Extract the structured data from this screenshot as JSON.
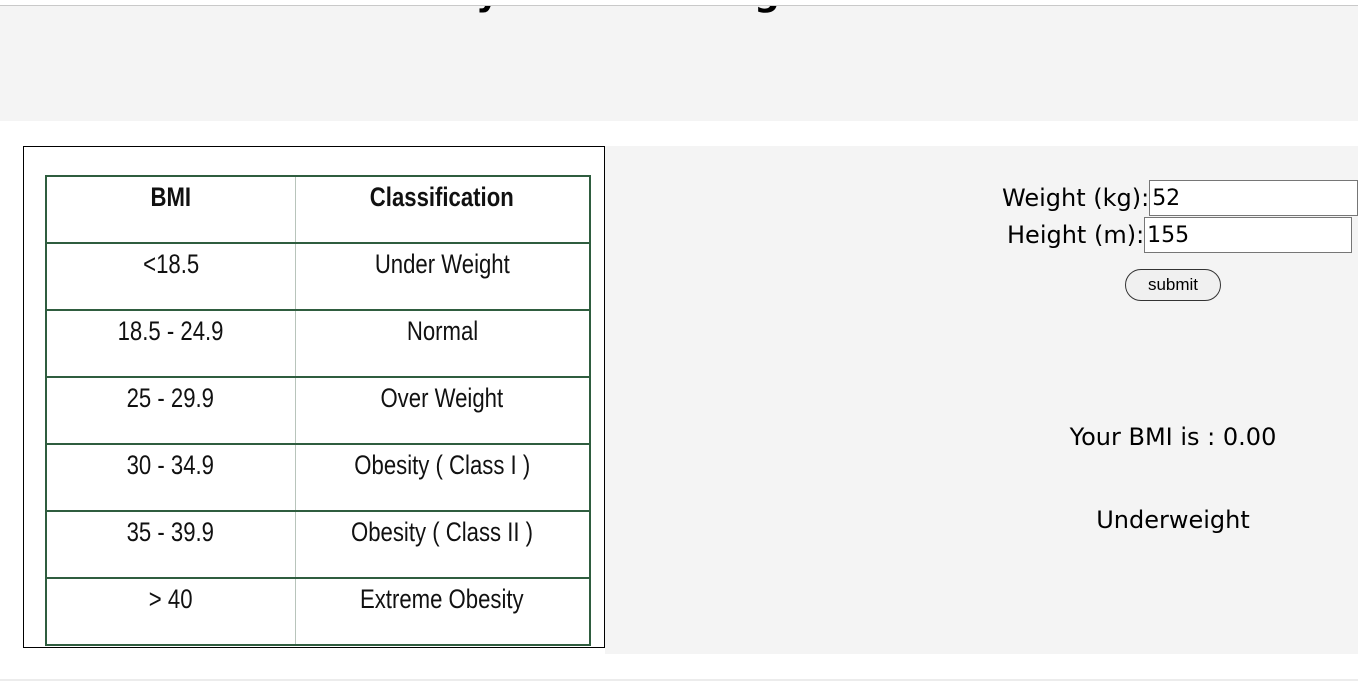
{
  "header": {
    "title": "Calculate your BMI using BMI calculator"
  },
  "bmi_table": {
    "headers": [
      "BMI",
      "Classification"
    ],
    "rows": [
      [
        "<18.5",
        "Under Weight"
      ],
      [
        "18.5 - 24.9",
        "Normal"
      ],
      [
        "25 - 29.9",
        "Over Weight"
      ],
      [
        "30 - 34.9",
        "Obesity ( Class I )"
      ],
      [
        "35 - 39.9",
        "Obesity ( Class II )"
      ],
      [
        "> 40",
        "Extreme Obesity"
      ]
    ]
  },
  "form": {
    "weight_label": "Weight (kg):",
    "weight_value": "52",
    "height_label": "Height (m):",
    "height_value": "155",
    "submit_label": "submit"
  },
  "result": {
    "bmi_text": "Your BMI is : 0.00",
    "classification": "Underweight"
  }
}
